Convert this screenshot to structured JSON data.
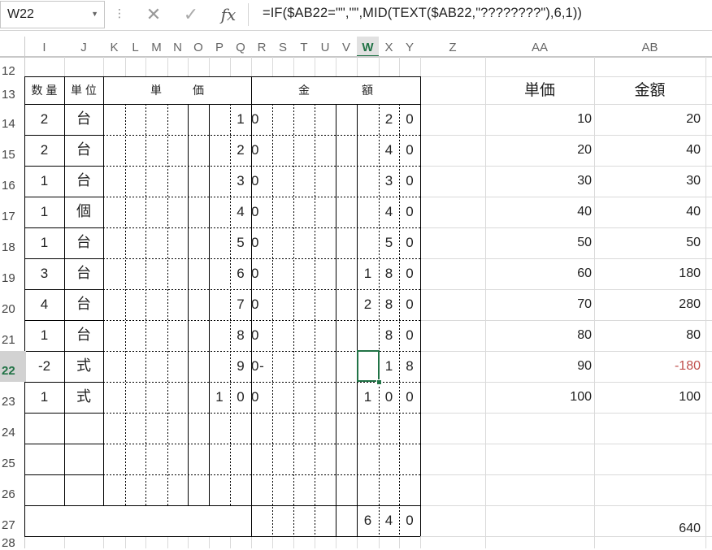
{
  "formula_bar": {
    "name_box": "W22",
    "formula": "=IF($AB22=\"\",\"\",MID(TEXT($AB22,\"????????\"),6,1))",
    "fx_label": "fx",
    "cancel_glyph": "✕",
    "enter_glyph": "✓",
    "menu_glyph": "⋮"
  },
  "columns": [
    "I",
    "J",
    "K",
    "L",
    "M",
    "N",
    "O",
    "P",
    "Q",
    "R",
    "S",
    "T",
    "U",
    "V",
    "W",
    "X",
    "Y",
    "Z",
    "AA",
    "AB"
  ],
  "selected_column": "W",
  "selected_row": "22",
  "rows": [
    "12",
    "13",
    "14",
    "15",
    "16",
    "17",
    "18",
    "19",
    "20",
    "21",
    "22",
    "23",
    "24",
    "25",
    "26",
    "27",
    "28"
  ],
  "header": {
    "qty": "数 量",
    "unit": "単 位",
    "price_a": "単",
    "price_b": "価",
    "amount_a": "金",
    "amount_b": "額",
    "aa_title": "単価",
    "ab_title": "金額"
  },
  "items": [
    {
      "qty": "2",
      "unit": "台",
      "price_digits": [
        "",
        "",
        "",
        "",
        "",
        "",
        "1",
        "0"
      ],
      "amount_digits": [
        "",
        "",
        "",
        "",
        "",
        "",
        "2",
        "0"
      ],
      "aa": "10",
      "ab": "20",
      "ab_negative": false
    },
    {
      "qty": "2",
      "unit": "台",
      "price_digits": [
        "",
        "",
        "",
        "",
        "",
        "",
        "2",
        "0"
      ],
      "amount_digits": [
        "",
        "",
        "",
        "",
        "",
        "",
        "4",
        "0"
      ],
      "aa": "20",
      "ab": "40",
      "ab_negative": false
    },
    {
      "qty": "1",
      "unit": "台",
      "price_digits": [
        "",
        "",
        "",
        "",
        "",
        "",
        "3",
        "0"
      ],
      "amount_digits": [
        "",
        "",
        "",
        "",
        "",
        "",
        "3",
        "0"
      ],
      "aa": "30",
      "ab": "30",
      "ab_negative": false
    },
    {
      "qty": "1",
      "unit": "個",
      "price_digits": [
        "",
        "",
        "",
        "",
        "",
        "",
        "4",
        "0"
      ],
      "amount_digits": [
        "",
        "",
        "",
        "",
        "",
        "",
        "4",
        "0"
      ],
      "aa": "40",
      "ab": "40",
      "ab_negative": false
    },
    {
      "qty": "1",
      "unit": "台",
      "price_digits": [
        "",
        "",
        "",
        "",
        "",
        "",
        "5",
        "0"
      ],
      "amount_digits": [
        "",
        "",
        "",
        "",
        "",
        "",
        "5",
        "0"
      ],
      "aa": "50",
      "ab": "50",
      "ab_negative": false
    },
    {
      "qty": "3",
      "unit": "台",
      "price_digits": [
        "",
        "",
        "",
        "",
        "",
        "",
        "6",
        "0"
      ],
      "amount_digits": [
        "",
        "",
        "",
        "",
        "",
        "1",
        "8",
        "0"
      ],
      "aa": "60",
      "ab": "180",
      "ab_negative": false
    },
    {
      "qty": "4",
      "unit": "台",
      "price_digits": [
        "",
        "",
        "",
        "",
        "",
        "",
        "7",
        "0"
      ],
      "amount_digits": [
        "",
        "",
        "",
        "",
        "",
        "2",
        "8",
        "0"
      ],
      "aa": "70",
      "ab": "280",
      "ab_negative": false
    },
    {
      "qty": "1",
      "unit": "台",
      "price_digits": [
        "",
        "",
        "",
        "",
        "",
        "",
        "8",
        "0"
      ],
      "amount_digits": [
        "",
        "",
        "",
        "",
        "",
        "",
        "8",
        "0"
      ],
      "aa": "80",
      "ab": "80",
      "ab_negative": false
    },
    {
      "qty": "-2",
      "unit": "式",
      "price_digits": [
        "",
        "",
        "",
        "",
        "",
        "",
        "9",
        "0"
      ],
      "amount_digits": [
        "-",
        "",
        "",
        "",
        "",
        "",
        "1",
        "8"
      ],
      "aa": "90",
      "ab": "-180",
      "ab_negative": true
    },
    {
      "qty": "1",
      "unit": "式",
      "price_digits": [
        "",
        "",
        "",
        "",
        "",
        "1",
        "0",
        "0"
      ],
      "amount_digits": [
        "",
        "",
        "",
        "",
        "",
        "1",
        "0",
        "0"
      ],
      "aa": "100",
      "ab": "100",
      "ab_negative": false
    }
  ],
  "total": {
    "amount_digits": [
      "",
      "",
      "",
      "",
      "",
      "6",
      "4",
      "0"
    ],
    "ab": "640"
  }
}
